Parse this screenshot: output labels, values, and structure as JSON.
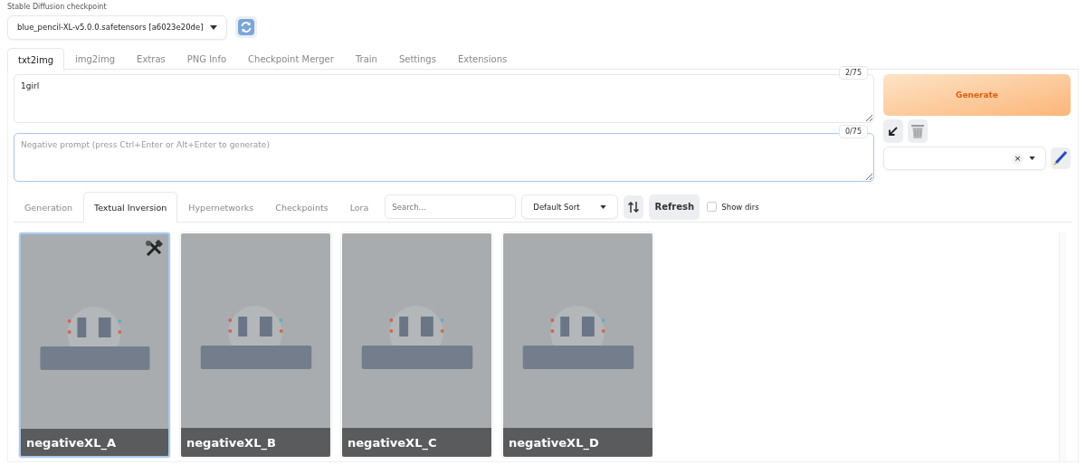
{
  "checkpoint": {
    "label": "Stable Diffusion checkpoint",
    "value": "blue_pencil-XL-v5.0.0.safetensors [a6023e20de]"
  },
  "tabs": [
    {
      "label": "txt2img",
      "selected": true
    },
    {
      "label": "img2img",
      "selected": false
    },
    {
      "label": "Extras",
      "selected": false
    },
    {
      "label": "PNG Info",
      "selected": false
    },
    {
      "label": "Checkpoint Merger",
      "selected": false
    },
    {
      "label": "Train",
      "selected": false
    },
    {
      "label": "Settings",
      "selected": false
    },
    {
      "label": "Extensions",
      "selected": false
    }
  ],
  "prompt": {
    "value": "1girl",
    "counter": "2/75",
    "focused": false
  },
  "negative_prompt": {
    "placeholder": "Negative prompt (press Ctrl+Enter or Alt+Enter to generate)",
    "counter": "0/75",
    "focused": true
  },
  "generate_button": "Generate",
  "style_clear": "×",
  "network_tabs": [
    {
      "label": "Generation",
      "selected": false
    },
    {
      "label": "Textual Inversion",
      "selected": true
    },
    {
      "label": "Hypernetworks",
      "selected": false
    },
    {
      "label": "Checkpoints",
      "selected": false
    },
    {
      "label": "Lora",
      "selected": false
    }
  ],
  "search": {
    "placeholder": "Search..."
  },
  "sort": {
    "value": "Default Sort"
  },
  "refresh_button": "Refresh",
  "show_dirs": {
    "label": "Show dirs",
    "checked": false
  },
  "cards": [
    {
      "name": "negativeXL_A",
      "selected": true
    },
    {
      "name": "negativeXL_B",
      "selected": false
    },
    {
      "name": "negativeXL_C",
      "selected": false
    },
    {
      "name": "negativeXL_D",
      "selected": false
    }
  ]
}
